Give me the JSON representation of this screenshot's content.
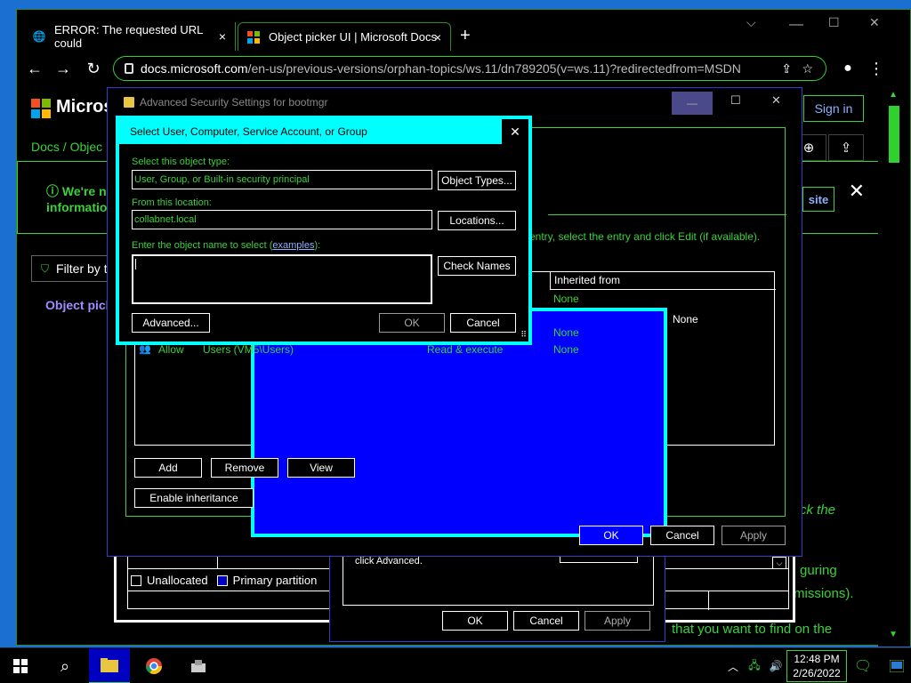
{
  "browser": {
    "tabs": [
      {
        "label": "ERROR: The requested URL could",
        "close": "×"
      },
      {
        "label": "Object picker UI | Microsoft Docs",
        "close": "×"
      }
    ],
    "new_tab": "+",
    "url_host": "docs.microsoft.com",
    "url_path": "/en-us/previous-versions/orphan-topics/ws.11/dn789205(v=ws.11)?redirectedfrom=MSDN",
    "controls": {
      "minimize": "⌵",
      "restore": "☐",
      "close": "✕"
    }
  },
  "page": {
    "brand": "Microso",
    "sign_in": "Sign in",
    "breadcrumb": {
      "docs": "Docs",
      "sep": "/",
      "current": "Objec"
    },
    "banner": {
      "line1": "We're n",
      "line2": "informatio",
      "button": "site",
      "close": "✕"
    },
    "filter_label": "Filter by t",
    "nav_link": "Object pick",
    "right_text": {
      "l1": "ck the",
      "l2": "guring",
      "l3": "rmissions).",
      "l4": "that you want to find on the"
    },
    "mid_text": "click Advanced."
  },
  "props_dialog": {
    "legend_unallocated": "Unallocated",
    "legend_primary": "Primary partition"
  },
  "mid_dialog": {
    "ok": "OK",
    "cancel": "Cancel",
    "apply": "Apply"
  },
  "adv_dialog": {
    "title": "Advanced Security Settings for bootmgr",
    "hint": "entry, select the entry and click Edit (if available).",
    "column_inherited": "Inherited from",
    "rows": [
      {
        "type": "",
        "principal": "",
        "access": "",
        "inherited": "None"
      },
      {
        "type": "",
        "principal": "",
        "access": "",
        "inherited": "None"
      },
      {
        "type": "",
        "principal": "",
        "access": "",
        "inherited": "None"
      },
      {
        "type": "Allow",
        "principal": "Users (VM5\\Users)",
        "access": "Read & execute",
        "inherited": "None"
      }
    ],
    "add": "Add",
    "remove": "Remove",
    "view": "View",
    "enable_inheritance": "Enable inheritance",
    "ok": "OK",
    "cancel": "Cancel",
    "apply": "Apply"
  },
  "select_dialog": {
    "title": "Select User, Computer, Service Account, or Group",
    "close": "✕",
    "object_type_label": "Select this object type:",
    "object_type_value": "User, Group, or Built-in security principal",
    "object_types_btn": "Object Types...",
    "location_label": "From this location:",
    "location_value": "collabnet.local",
    "locations_btn": "Locations...",
    "name_label_pre": "Enter the object name to select (",
    "name_label_link": "examples",
    "name_label_post": "):",
    "check_names_btn": "Check Names",
    "advanced_btn": "Advanced...",
    "ok": "OK",
    "cancel": "Cancel"
  },
  "taskbar": {
    "time": "12:48 PM",
    "date": "2/26/2022"
  }
}
